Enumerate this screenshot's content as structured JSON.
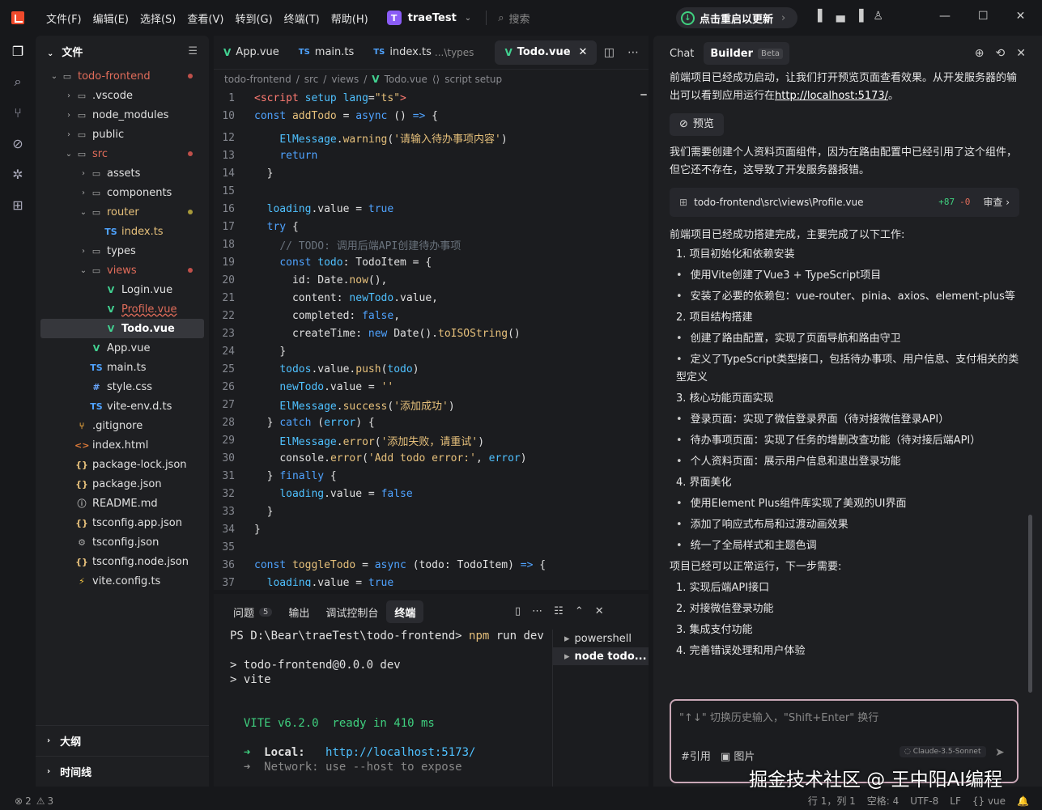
{
  "titlebar": {
    "menu": [
      "文件(F)",
      "编辑(E)",
      "选择(S)",
      "查看(V)",
      "转到(G)",
      "终端(T)",
      "帮助(H)"
    ],
    "project_initial": "T",
    "project": "traeTest",
    "search_placeholder": "搜索",
    "restart_label": "点击重启以更新"
  },
  "explorer": {
    "title": "文件",
    "tree": [
      {
        "label": "todo-frontend",
        "depth": 0,
        "type": "folder-open",
        "color": "#e06c5a",
        "dot": "#c0504a"
      },
      {
        "label": ".vscode",
        "depth": 1,
        "type": "folder"
      },
      {
        "label": "node_modules",
        "depth": 1,
        "type": "folder"
      },
      {
        "label": "public",
        "depth": 1,
        "type": "folder"
      },
      {
        "label": "src",
        "depth": 1,
        "type": "folder-open",
        "color": "#e06c5a",
        "dot": "#c0504a"
      },
      {
        "label": "assets",
        "depth": 2,
        "type": "folder"
      },
      {
        "label": "components",
        "depth": 2,
        "type": "folder"
      },
      {
        "label": "router",
        "depth": 2,
        "type": "folder-open",
        "color": "#e6c07b",
        "dot": "#a89a3a"
      },
      {
        "label": "index.ts",
        "depth": 3,
        "type": "ts",
        "color": "#e6c07b"
      },
      {
        "label": "types",
        "depth": 2,
        "type": "folder"
      },
      {
        "label": "views",
        "depth": 2,
        "type": "folder-open",
        "color": "#e06c5a",
        "dot": "#c0504a"
      },
      {
        "label": "Login.vue",
        "depth": 3,
        "type": "vue"
      },
      {
        "label": "Profile.vue",
        "depth": 3,
        "type": "vue",
        "color": "#e06c5a"
      },
      {
        "label": "Todo.vue",
        "depth": 3,
        "type": "vue",
        "selected": true
      },
      {
        "label": "App.vue",
        "depth": 2,
        "type": "vue"
      },
      {
        "label": "main.ts",
        "depth": 2,
        "type": "ts"
      },
      {
        "label": "style.css",
        "depth": 2,
        "type": "css"
      },
      {
        "label": "vite-env.d.ts",
        "depth": 2,
        "type": "ts"
      },
      {
        "label": ".gitignore",
        "depth": 1,
        "type": "git"
      },
      {
        "label": "index.html",
        "depth": 1,
        "type": "html"
      },
      {
        "label": "package-lock.json",
        "depth": 1,
        "type": "json"
      },
      {
        "label": "package.json",
        "depth": 1,
        "type": "json"
      },
      {
        "label": "README.md",
        "depth": 1,
        "type": "md"
      },
      {
        "label": "tsconfig.app.json",
        "depth": 1,
        "type": "json"
      },
      {
        "label": "tsconfig.json",
        "depth": 1,
        "type": "gear"
      },
      {
        "label": "tsconfig.node.json",
        "depth": 1,
        "type": "json"
      },
      {
        "label": "vite.config.ts",
        "depth": 1,
        "type": "vite"
      }
    ],
    "outline_label": "大纲",
    "timeline_label": "时间线"
  },
  "editor": {
    "tabs": [
      {
        "label": "App.vue",
        "icon": "vue",
        "active": false
      },
      {
        "label": "main.ts",
        "icon": "ts",
        "active": false
      },
      {
        "label": "index.ts",
        "hint": "...\\types",
        "icon": "ts",
        "active": false
      },
      {
        "label": "Todo.vue",
        "icon": "vue",
        "active": true
      }
    ],
    "breadcrumb": [
      "todo-frontend",
      "src",
      "views",
      "Todo.vue",
      "script setup"
    ],
    "lines": [
      {
        "n": "1",
        "html": "<span class='tag'>&lt;script</span> <span class='pr'>setup</span> <span class='pr'>lang</span><span class='pl'>=</span><span class='str'>\"ts\"</span><span class='tag'>&gt;</span>"
      },
      {
        "n": "10",
        "html": "<span class='kw'>const</span> <span class='fn'>addTodo</span> <span class='pl'>=</span> <span class='kw'>async</span> <span class='pl'>() </span><span class='kw'>=&gt;</span><span class='pl'> {</span>"
      },
      {
        "n": "12",
        "html": "    <span class='pr'>ElMessage</span><span class='pl'>.</span><span class='fn'>warning</span><span class='pl'>(</span><span class='str'>'请输入待办事项内容'</span><span class='pl'>)</span>"
      },
      {
        "n": "13",
        "html": "    <span class='kw'>return</span>"
      },
      {
        "n": "14",
        "html": "  <span class='pl'>}</span>"
      },
      {
        "n": "15",
        "html": ""
      },
      {
        "n": "16",
        "html": "  <span class='pr'>loading</span><span class='pl'>.value = </span><span class='bool'>true</span>"
      },
      {
        "n": "17",
        "html": "  <span class='kw'>try</span><span class='pl'> {</span>"
      },
      {
        "n": "18",
        "html": "    <span class='cm'>// TODO: 调用后端API创建待办事项</span>"
      },
      {
        "n": "19",
        "html": "    <span class='kw'>const</span> <span class='pr'>todo</span><span class='pl'>: TodoItem = {</span>"
      },
      {
        "n": "20",
        "html": "      <span class='pl'>id: Date.</span><span class='fn'>now</span><span class='pl'>(),</span>"
      },
      {
        "n": "21",
        "html": "      <span class='pl'>content: </span><span class='pr'>newTodo</span><span class='pl'>.value,</span>"
      },
      {
        "n": "22",
        "html": "      <span class='pl'>completed: </span><span class='bool'>false</span><span class='pl'>,</span>"
      },
      {
        "n": "23",
        "html": "      <span class='pl'>createTime: </span><span class='kw'>new</span><span class='pl'> Date().</span><span class='fn'>toISOString</span><span class='pl'>()</span>"
      },
      {
        "n": "24",
        "html": "    <span class='pl'>}</span>"
      },
      {
        "n": "25",
        "html": "    <span class='pr'>todos</span><span class='pl'>.value.</span><span class='fn'>push</span><span class='pl'>(</span><span class='pr'>todo</span><span class='pl'>)</span>"
      },
      {
        "n": "26",
        "html": "    <span class='pr'>newTodo</span><span class='pl'>.value = </span><span class='str'>''</span>"
      },
      {
        "n": "27",
        "html": "    <span class='pr'>ElMessage</span><span class='pl'>.</span><span class='fn'>success</span><span class='pl'>(</span><span class='str'>'添加成功'</span><span class='pl'>)</span>"
      },
      {
        "n": "28",
        "html": "  <span class='pl'>} </span><span class='kw'>catch</span><span class='pl'> (</span><span class='pr'>error</span><span class='pl'>) {</span>"
      },
      {
        "n": "29",
        "html": "    <span class='pr'>ElMessage</span><span class='pl'>.</span><span class='fn'>error</span><span class='pl'>(</span><span class='str'>'添加失败，请重试'</span><span class='pl'>)</span>"
      },
      {
        "n": "30",
        "html": "    <span class='pl'>console.</span><span class='fn'>error</span><span class='pl'>(</span><span class='str'>'Add todo error:'</span><span class='pl'>, </span><span class='pr'>error</span><span class='pl'>)</span>"
      },
      {
        "n": "31",
        "html": "  <span class='pl'>} </span><span class='kw'>finally</span><span class='pl'> {</span>"
      },
      {
        "n": "32",
        "html": "    <span class='pr'>loading</span><span class='pl'>.value = </span><span class='bool'>false</span>"
      },
      {
        "n": "33",
        "html": "  <span class='pl'>}</span>"
      },
      {
        "n": "34",
        "html": "<span class='pl'>}</span>"
      },
      {
        "n": "35",
        "html": ""
      },
      {
        "n": "36",
        "html": "<span class='kw'>const</span> <span class='fn'>toggleTodo</span> <span class='pl'>= </span><span class='kw'>async</span><span class='pl'> (todo: TodoItem) </span><span class='kw'>=&gt;</span><span class='pl'> {</span>"
      },
      {
        "n": "37",
        "html": "  <span class='pr'>loading</span><span class='pl'>.value = </span><span class='bool'>true</span>"
      }
    ]
  },
  "panel": {
    "tabs": [
      {
        "label": "问题",
        "badge": "5"
      },
      {
        "label": "输出"
      },
      {
        "label": "调试控制台"
      },
      {
        "label": "终端",
        "active": true
      }
    ],
    "terminal": [
      "PS D:\\Bear\\traeTest\\todo-frontend> npm run dev",
      "",
      "> todo-frontend@0.0.0 dev",
      "> vite",
      "",
      "",
      "  VITE v6.2.0  ready in 410 ms",
      "",
      "  ➜  Local:   http://localhost:5173/",
      "  ➜  Network: use --host to expose"
    ],
    "terminal_list": [
      "powershell",
      "node todo..."
    ]
  },
  "chat": {
    "tab_chat": "Chat",
    "tab_builder": "Builder",
    "beta": "Beta",
    "intro": "前端项目已经成功启动，让我们打开预览页面查看效果。从开发服务器的输出可以看到应用运行在",
    "url": "http://localhost:5173/",
    "intro_end": "。",
    "preview_btn": "预览",
    "msg2": "我们需要创建个人资料页面组件，因为在路由配置中已经引用了这个组件，但它还不存在，这导致了开发服务器报错。",
    "file_path": "todo-frontend\\src\\views\\Profile.vue",
    "file_add": "+87",
    "file_del": "-0",
    "review": "审查",
    "summary": "前端项目已经成功搭建完成，主要完成了以下工作:",
    "items": [
      {
        "t": "num",
        "text": "1. 项目初始化和依赖安装"
      },
      {
        "t": "bul",
        "text": "使用Vite创建了Vue3 + TypeScript项目"
      },
      {
        "t": "bul",
        "text": "安装了必要的依赖包：vue-router、pinia、axios、element-plus等"
      },
      {
        "t": "num",
        "text": "2. 项目结构搭建"
      },
      {
        "t": "bul",
        "text": "创建了路由配置，实现了页面导航和路由守卫"
      },
      {
        "t": "bul",
        "text": "定义了TypeScript类型接口，包括待办事项、用户信息、支付相关的类型定义"
      },
      {
        "t": "num",
        "text": "3. 核心功能页面实现"
      },
      {
        "t": "bul",
        "text": "登录页面：实现了微信登录界面（待对接微信登录API）"
      },
      {
        "t": "bul",
        "text": "待办事项页面：实现了任务的增删改查功能（待对接后端API）"
      },
      {
        "t": "bul",
        "text": "个人资料页面：展示用户信息和退出登录功能"
      },
      {
        "t": "num",
        "text": "4. 界面美化"
      },
      {
        "t": "bul",
        "text": "使用Element Plus组件库实现了美观的UI界面"
      },
      {
        "t": "bul",
        "text": "添加了响应式布局和过渡动画效果"
      },
      {
        "t": "bul",
        "text": "统一了全局样式和主题色调"
      },
      {
        "t": "txt",
        "text": "项目已经可以正常运行，下一步需要:"
      },
      {
        "t": "num",
        "text": "1. 实现后端API接口"
      },
      {
        "t": "num",
        "text": "2. 对接微信登录功能"
      },
      {
        "t": "num",
        "text": "3. 集成支付功能"
      },
      {
        "t": "num",
        "text": "4. 完善错误处理和用户体验"
      }
    ],
    "input_placeholder": "\"↑↓\" 切换历史输入，\"Shift+Enter\" 换行",
    "ref_label": "#引用",
    "image_label": "图片",
    "model": "Claude-3.5-Sonnet"
  },
  "status": {
    "errors": "2",
    "warnings": "3",
    "position": "行 1，列 1",
    "spaces": "空格: 4",
    "encoding": "UTF-8",
    "eol": "LF",
    "lang": "vue"
  },
  "watermark": "掘金技术社区 @ 王中阳AI编程"
}
